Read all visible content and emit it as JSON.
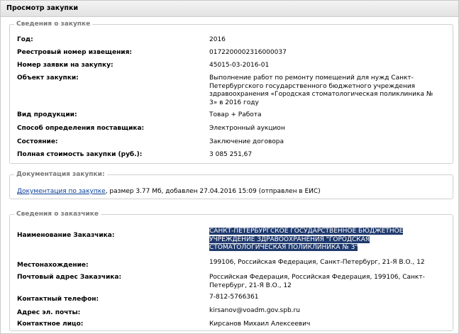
{
  "window": {
    "title": "Просмотр закупки"
  },
  "purchase": {
    "legend": "Сведения о закупке",
    "fields": [
      {
        "label": "Год:",
        "value": "2016"
      },
      {
        "label": "Реестровый номер извещения:",
        "value": "0172200002316000037"
      },
      {
        "label": "Номер заявки на закупку:",
        "value": "45015-03-2016-01"
      },
      {
        "label": "Объект закупки:",
        "value": "Выполнение работ по ремонту помещений для нужд Санкт-Петербургского государственного бюджетного учреждения здравоохранения «Городская стоматологическая поликлиника № 3» в 2016 году"
      },
      {
        "label": "Вид продукции:",
        "value": "Товар + Работа"
      },
      {
        "label": "Способ определения поставщика:",
        "value": "Электронный аукцион"
      },
      {
        "label": "Состояние:",
        "value": "Заключение договора"
      },
      {
        "label": "Полная стоимость закупки (руб.):",
        "value": "3 085 251,67"
      }
    ]
  },
  "documentation": {
    "legend": "Документация закупки:",
    "link_label": "Документация по закупке",
    "info": ", размер 3.77 Мб, добавлен 27.04.2016 15:09 (отправлен в ЕИС)"
  },
  "customer": {
    "legend": "Сведения о заказчике",
    "fields": [
      {
        "label": "Наименование Заказчика:",
        "value": "САНКТ-ПЕТЕРБУРГСКОЕ ГОСУДАРСТВЕННОЕ БЮДЖЕТНОЕ УЧРЕЖДЕНИЕ ЗДРАВООХРАНЕНИЯ \"ГОРОДСКАЯ СТОМАТОЛОГИЧЕСКАЯ ПОЛИКЛИНИКА № 3\""
      },
      {
        "label": "Местонахождение:",
        "value": "199106, Российская Федерация, Санкт-Петербург, 21-Я В.О., 12"
      },
      {
        "label": "Почтовый адрес Заказчика:",
        "value": "Российская Федерация, Российская Федерация, 199106, Санкт-Петербург, 21-Я В.О., 12"
      },
      {
        "label": "Контактный телефон:",
        "value": "7-812-5766361"
      },
      {
        "label": "Адрес эл. почты:",
        "value": "kirsanov@voadm.gov.spb.ru"
      },
      {
        "label": "Контактное лицо:",
        "value": "Кирсанов Михаил Алексеевич"
      }
    ]
  }
}
